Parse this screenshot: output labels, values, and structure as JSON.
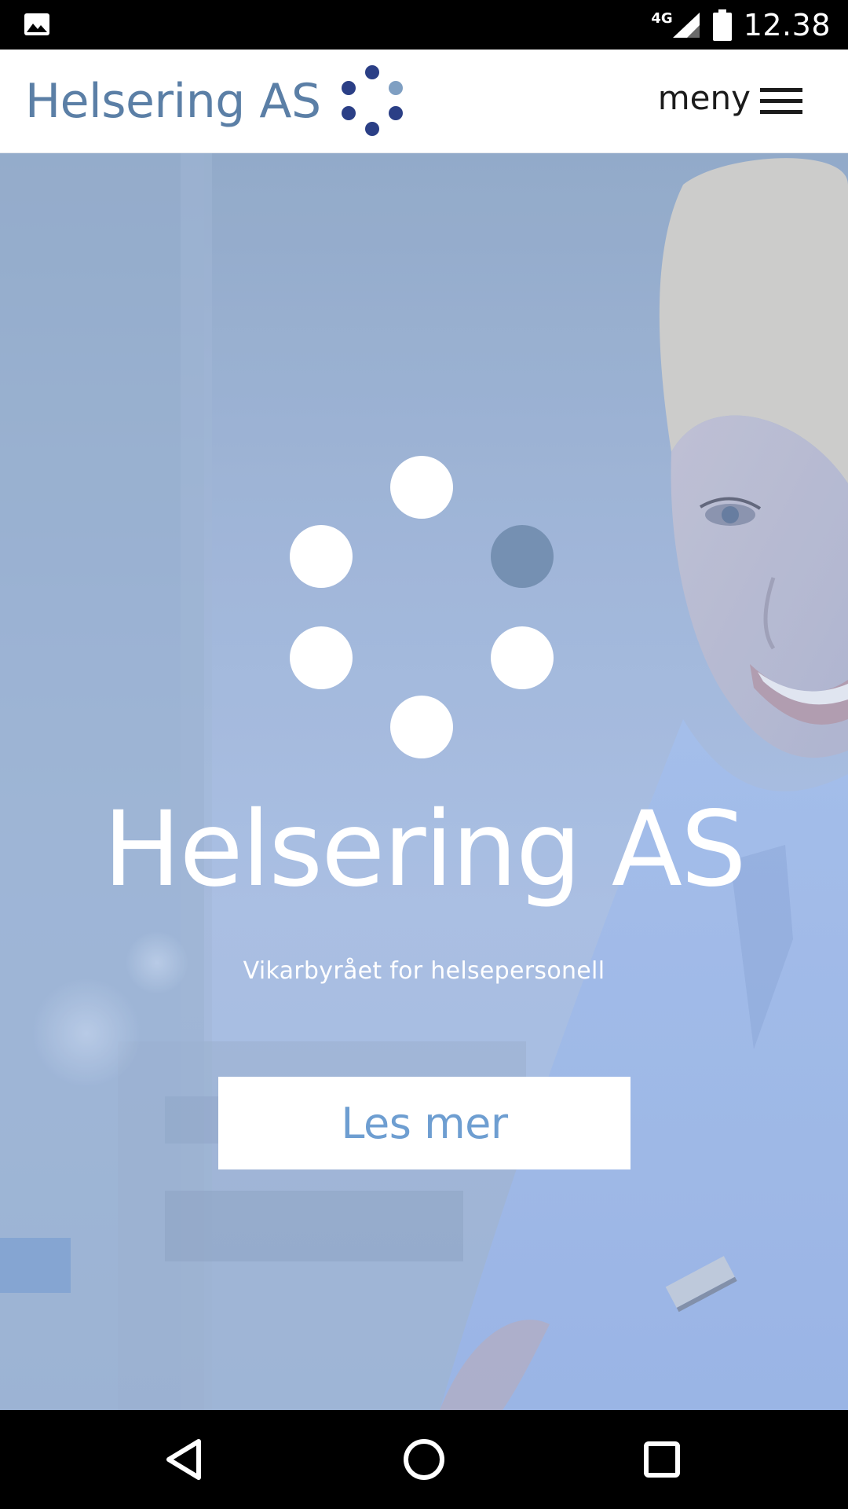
{
  "status_bar": {
    "left_icon": "image-icon",
    "network_type": "4G",
    "signal_icon": "signal-icon",
    "battery_icon": "battery-icon",
    "time": "12.38"
  },
  "header": {
    "brand_name": "Helsering AS",
    "logo_icon": "dot-ring-logo-icon",
    "menu_label": "meny",
    "menu_icon": "hamburger-icon",
    "colors": {
      "brand_text": "#5b7fa6",
      "logo_dark": "#2b3f86",
      "logo_light": "#7f9fc2"
    }
  },
  "hero": {
    "logo_icon": "dot-ring-logo-icon",
    "title": "Helsering AS",
    "tagline": "Vikarbyrået for helsepersonell",
    "button_label": "Les mer",
    "colors": {
      "overlay": "#9fb6dc",
      "button_text": "#6e9ed1",
      "accent_dot": "#7590b2"
    }
  },
  "nav_bar": {
    "back_icon": "back-triangle-icon",
    "home_icon": "home-circle-icon",
    "recents_icon": "recents-square-icon"
  }
}
